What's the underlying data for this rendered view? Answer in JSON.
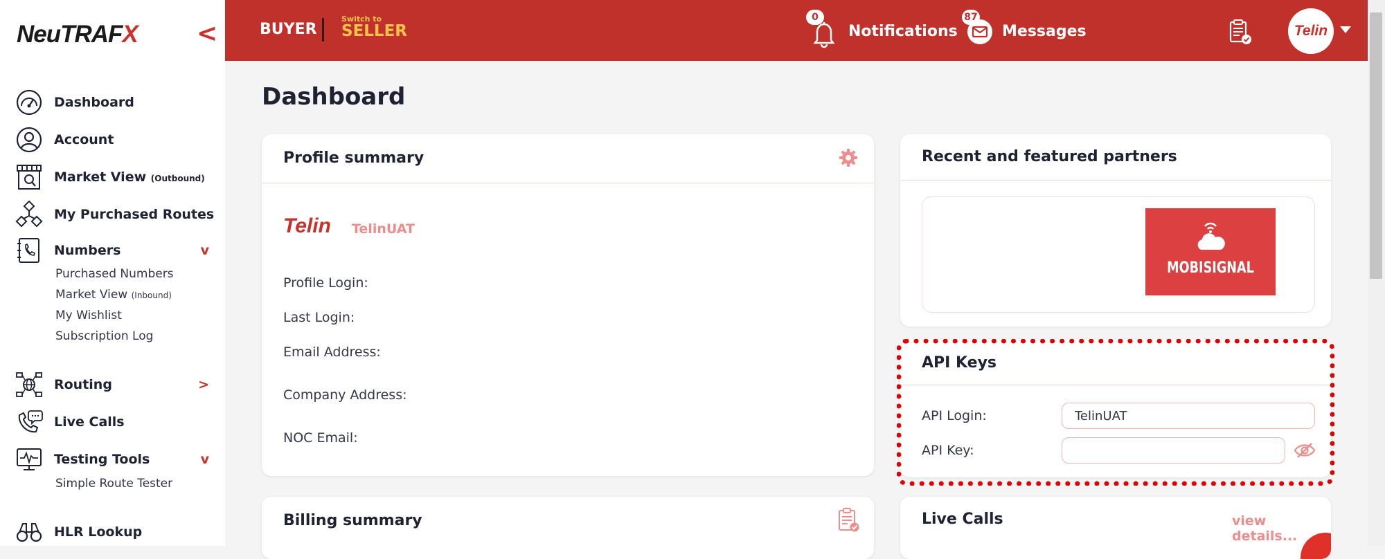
{
  "sidebar": {
    "logo": {
      "part1": "NeuTRAF",
      "part2": "X"
    },
    "collapse": "<",
    "items": [
      {
        "label": "Dashboard"
      },
      {
        "label": "Account"
      },
      {
        "label": "Market View",
        "note": "(Outbound)"
      },
      {
        "label": "My Purchased Routes"
      },
      {
        "label": "Numbers",
        "chevron": "v"
      },
      {
        "label": "Routing",
        "chevron": ">"
      },
      {
        "label": "Live Calls"
      },
      {
        "label": "Testing Tools",
        "chevron": "v"
      },
      {
        "label": "HLR Lookup"
      }
    ],
    "numbers_sub": [
      {
        "label": "Purchased Numbers"
      },
      {
        "label": "Market View",
        "note": "(Inbound)"
      },
      {
        "label": "My Wishlist"
      },
      {
        "label": "Subscription Log"
      }
    ],
    "testing_sub": [
      {
        "label": "Simple Route Tester"
      }
    ]
  },
  "header": {
    "buyer": "BUYER",
    "switch_small": "Switch to",
    "switch_big": "SELLER",
    "notifications": {
      "label": "Notifications",
      "count": "0"
    },
    "messages": {
      "label": "Messages",
      "count": "87"
    },
    "avatar_text": "Telin"
  },
  "main": {
    "title": "Dashboard",
    "profile": {
      "title": "Profile summary",
      "company_logo": "Telin",
      "company_name": "TelinUAT",
      "fields": [
        "Profile Login:",
        "Last Login:",
        "Email Address:",
        "Company Address:",
        "NOC Email:"
      ]
    },
    "partners": {
      "title": "Recent and featured partners",
      "partner_name": "MOBISIGNAL"
    },
    "api_keys": {
      "title": "API Keys",
      "login_label": "API Login:",
      "login_value": "TelinUAT",
      "key_label": "API Key:",
      "key_value": ""
    },
    "billing": {
      "title": "Billing summary"
    },
    "live_calls": {
      "title": "Live Calls",
      "link": "view details..."
    }
  },
  "colors": {
    "brand_red": "#c0312b",
    "accent_yellow": "#f4c44a",
    "soft_red": "#ee8d8d",
    "highlight_red": "#e00000"
  }
}
